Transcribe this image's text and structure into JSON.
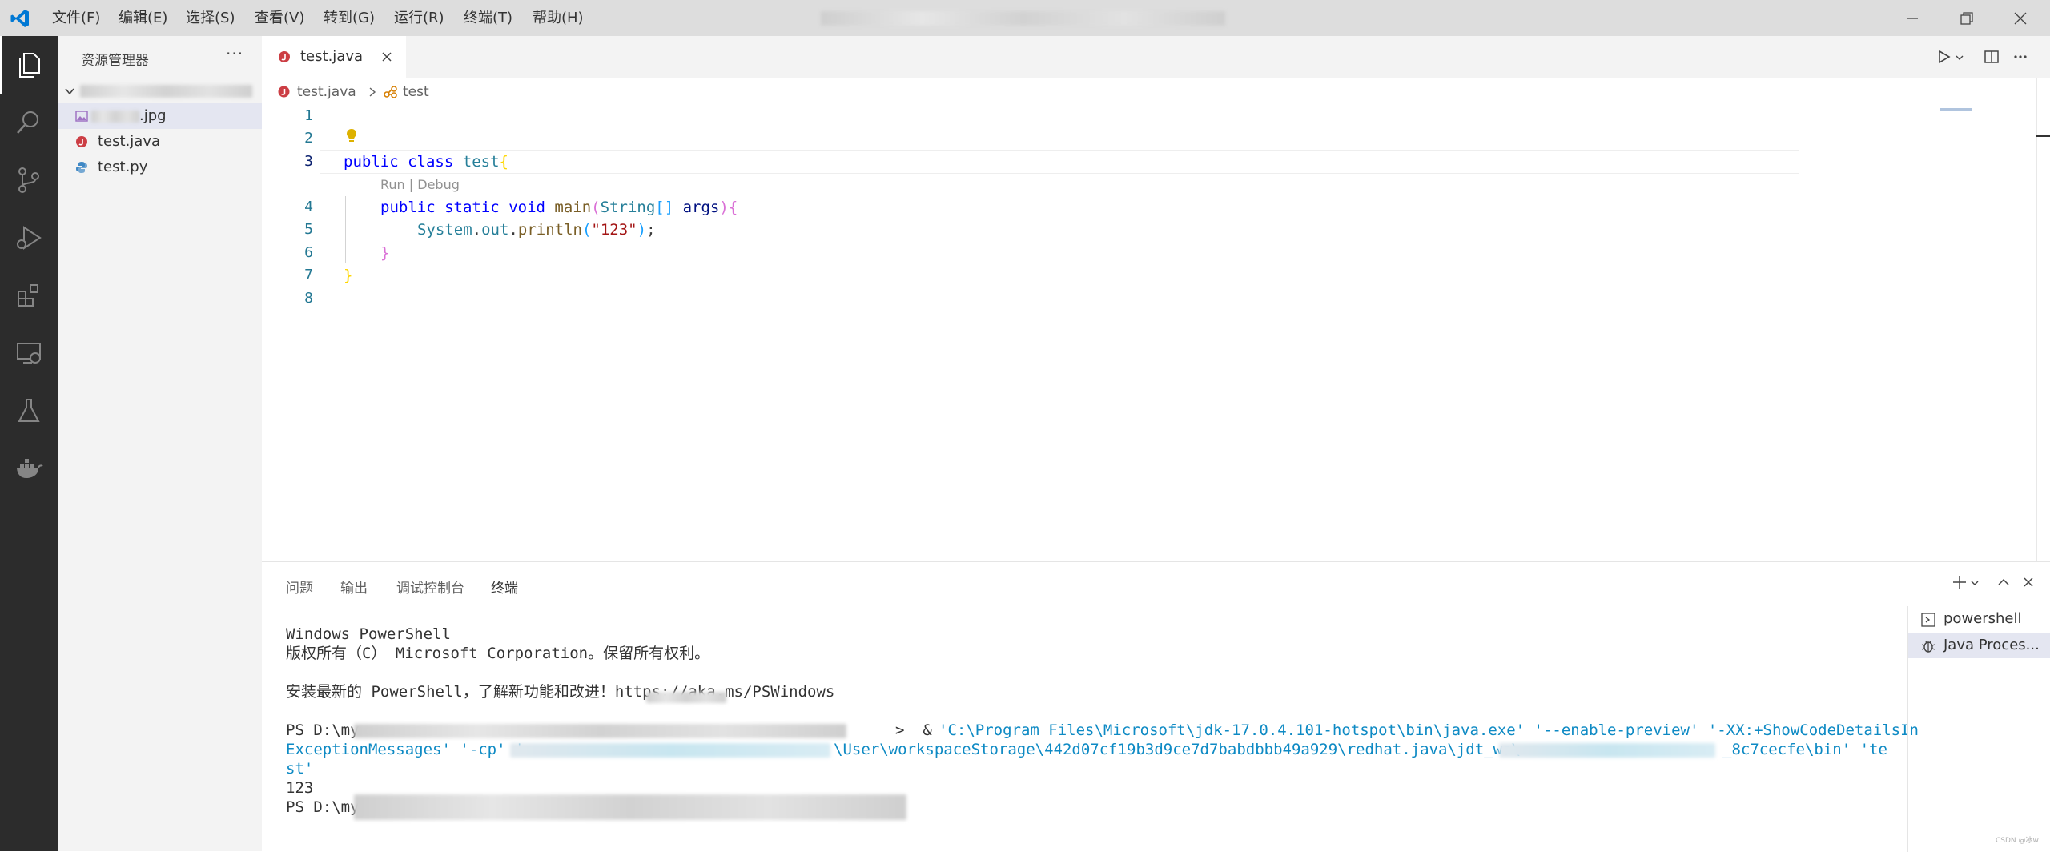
{
  "menu": [
    "文件(F)",
    "编辑(E)",
    "选择(S)",
    "查看(V)",
    "转到(G)",
    "运行(R)",
    "终端(T)",
    "帮助(H)"
  ],
  "sidebar": {
    "title": "资源管理器",
    "more": "···",
    "files": [
      {
        "name": ".jpg",
        "type": "image"
      },
      {
        "name": "test.java",
        "type": "java"
      },
      {
        "name": "test.py",
        "type": "python"
      }
    ]
  },
  "editor": {
    "tab_label": "test.java",
    "breadcrumb": {
      "file": "test.java",
      "symbol": "test"
    },
    "line_numbers": [
      "1",
      "2",
      "3",
      "4",
      "5",
      "6",
      "7",
      "8"
    ],
    "codelens": "Run | Debug",
    "code": {
      "l3": {
        "kw1": "public",
        "kw2": "class",
        "name": "test",
        "brace": "{"
      },
      "l4": {
        "kw1": "public",
        "kw2": "static",
        "kw3": "void",
        "fn": "main",
        "paren_open": "(",
        "type": "String",
        "arr": "[]",
        "arg": "args",
        "paren_close": ")",
        "brace": "{"
      },
      "l5": {
        "obj": "System",
        "dot1": ".",
        "field": "out",
        "dot2": ".",
        "fn": "println",
        "paren_open": "(",
        "str": "\"123\"",
        "paren_close": ")",
        "semi": ";"
      },
      "l6": {
        "brace": "}"
      },
      "l7": {
        "brace": "}"
      }
    }
  },
  "panel": {
    "tabs": [
      "问题",
      "输出",
      "调试控制台",
      "终端"
    ],
    "active_tab": "终端",
    "terminal": {
      "l1": "Windows PowerShell",
      "l2": "版权所有（C） Microsoft Corporation。保留所有权利。",
      "l3": "安装最新的 PowerShell，了解新功能和改进！https://aka.ms/PSWindows",
      "l4_prompt": "PS D:\\my",
      "l4_tail": ">  & ",
      "l4_cmd": "'C:\\Program Files\\Microsoft\\jdk-17.0.4.101-hotspot\\bin\\java.exe' '--enable-preview' '-XX:+ShowCodeDetailsIn",
      "l5_a": "ExceptionMessages' '-cp' '",
      "l5_b": "\\User\\workspaceStorage\\442d07cf19b3d9ce7d7babdbbb49a929\\redhat.java\\jdt_ws\\",
      "l5_c": "_8c7cecfe\\bin' 'te",
      "l6": "st'",
      "l7": "123",
      "l8_prompt": "PS D:\\my"
    },
    "sessions": [
      "powershell",
      "Java Proces..."
    ]
  },
  "watermark": "CSDN @冰w"
}
